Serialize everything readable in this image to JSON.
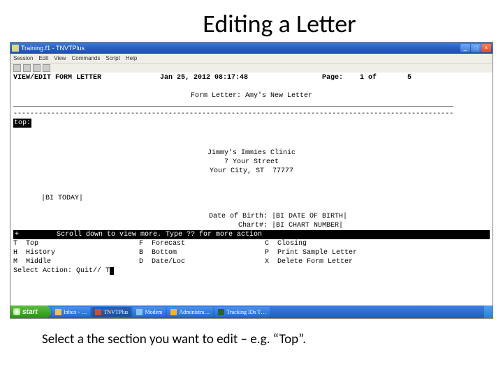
{
  "slide": {
    "title": "Editing a Letter",
    "caption": "Select a the section you want to edit – e.g. “Top”."
  },
  "window": {
    "title": "Training.f1 - TNVTPlus",
    "menus": [
      "Session",
      "Edit",
      "View",
      "Commands",
      "Script",
      "Help"
    ]
  },
  "terminal": {
    "headerTitle": "VIEW/EDIT FORM LETTER",
    "headerDate": "Jan 25, 2012 08:17:48",
    "pageLabel": "Page:",
    "pageCurrent": "1 of",
    "pageTotal": "5",
    "subtitle": "Form Letter: Amy's New Letter",
    "topBadge": "top:",
    "clinic": {
      "name": "Jimmy's Immies Clinic",
      "street": "7 Your Street",
      "cityline": "Your City, ST  77777"
    },
    "biToday": "|BI TODAY|",
    "dob": "Date of Birth: |BI DATE OF BIRTH|",
    "chart": "Chart#: |BI CHART NUMBER|",
    "invertPrefix": "+",
    "invertMsg": "Scroll down to view more.  Type ?? for more action",
    "menu": [
      {
        "key": "T",
        "label": "Top"
      },
      {
        "key": "F",
        "label": "Forecast"
      },
      {
        "key": "C",
        "label": "Closing"
      },
      {
        "key": "H",
        "label": "History"
      },
      {
        "key": "B",
        "label": "Bottom"
      },
      {
        "key": "P",
        "label": "Print Sample Letter"
      },
      {
        "key": "M",
        "label": "Middle"
      },
      {
        "key": "D",
        "label": "Date/Loc"
      },
      {
        "key": "X",
        "label": "Delete Form Letter"
      }
    ],
    "prompt": "Select Action: Quit// T"
  },
  "taskbar": {
    "start": "start",
    "items": [
      "Inbox - …",
      "TNVTPlus",
      "Modem",
      "Administra…",
      "Tracking IDs  T…"
    ],
    "tray": " "
  }
}
